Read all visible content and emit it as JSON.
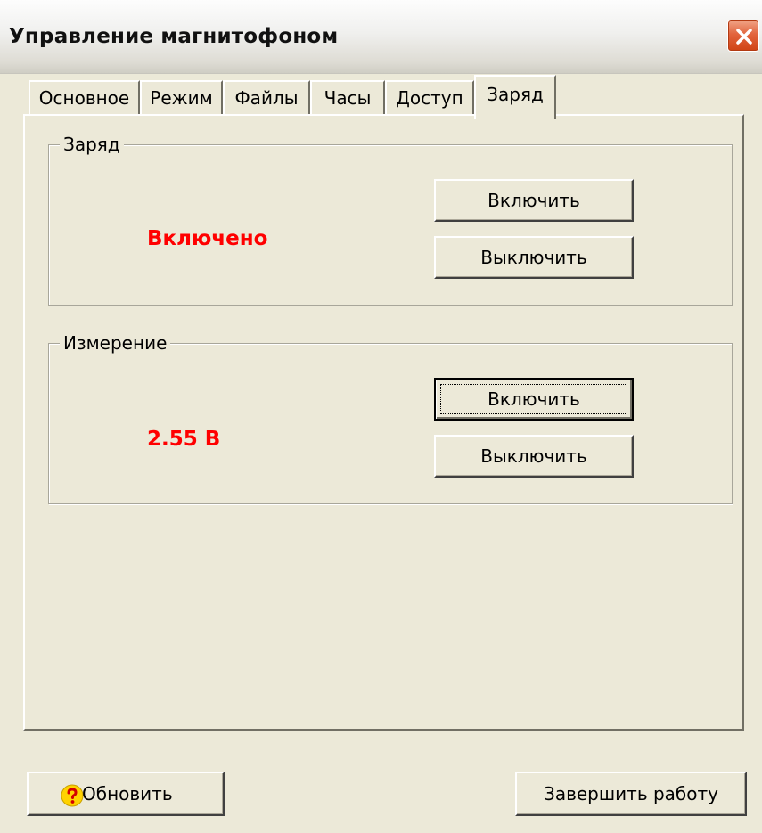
{
  "window": {
    "title": "Управление магнитофоном"
  },
  "tabs": [
    {
      "label": "Основное"
    },
    {
      "label": "Режим"
    },
    {
      "label": "Файлы"
    },
    {
      "label": "Часы"
    },
    {
      "label": "Доступ"
    },
    {
      "label": "Заряд",
      "active": true
    }
  ],
  "charge_group": {
    "title": "Заряд",
    "status": "Включено",
    "on_label": "Включить",
    "off_label": "Выключить"
  },
  "measure_group": {
    "title": "Измерение",
    "value": "2.55 В",
    "on_label": "Включить",
    "off_label": "Выключить"
  },
  "footer": {
    "refresh_label": "Обновить",
    "exit_label": "Завершить работу"
  },
  "icons": {
    "close": "close-icon",
    "help": "help-icon"
  },
  "colors": {
    "status_red": "#ff0000",
    "close_button": "#e2643d",
    "help_icon": "#ffd200"
  }
}
